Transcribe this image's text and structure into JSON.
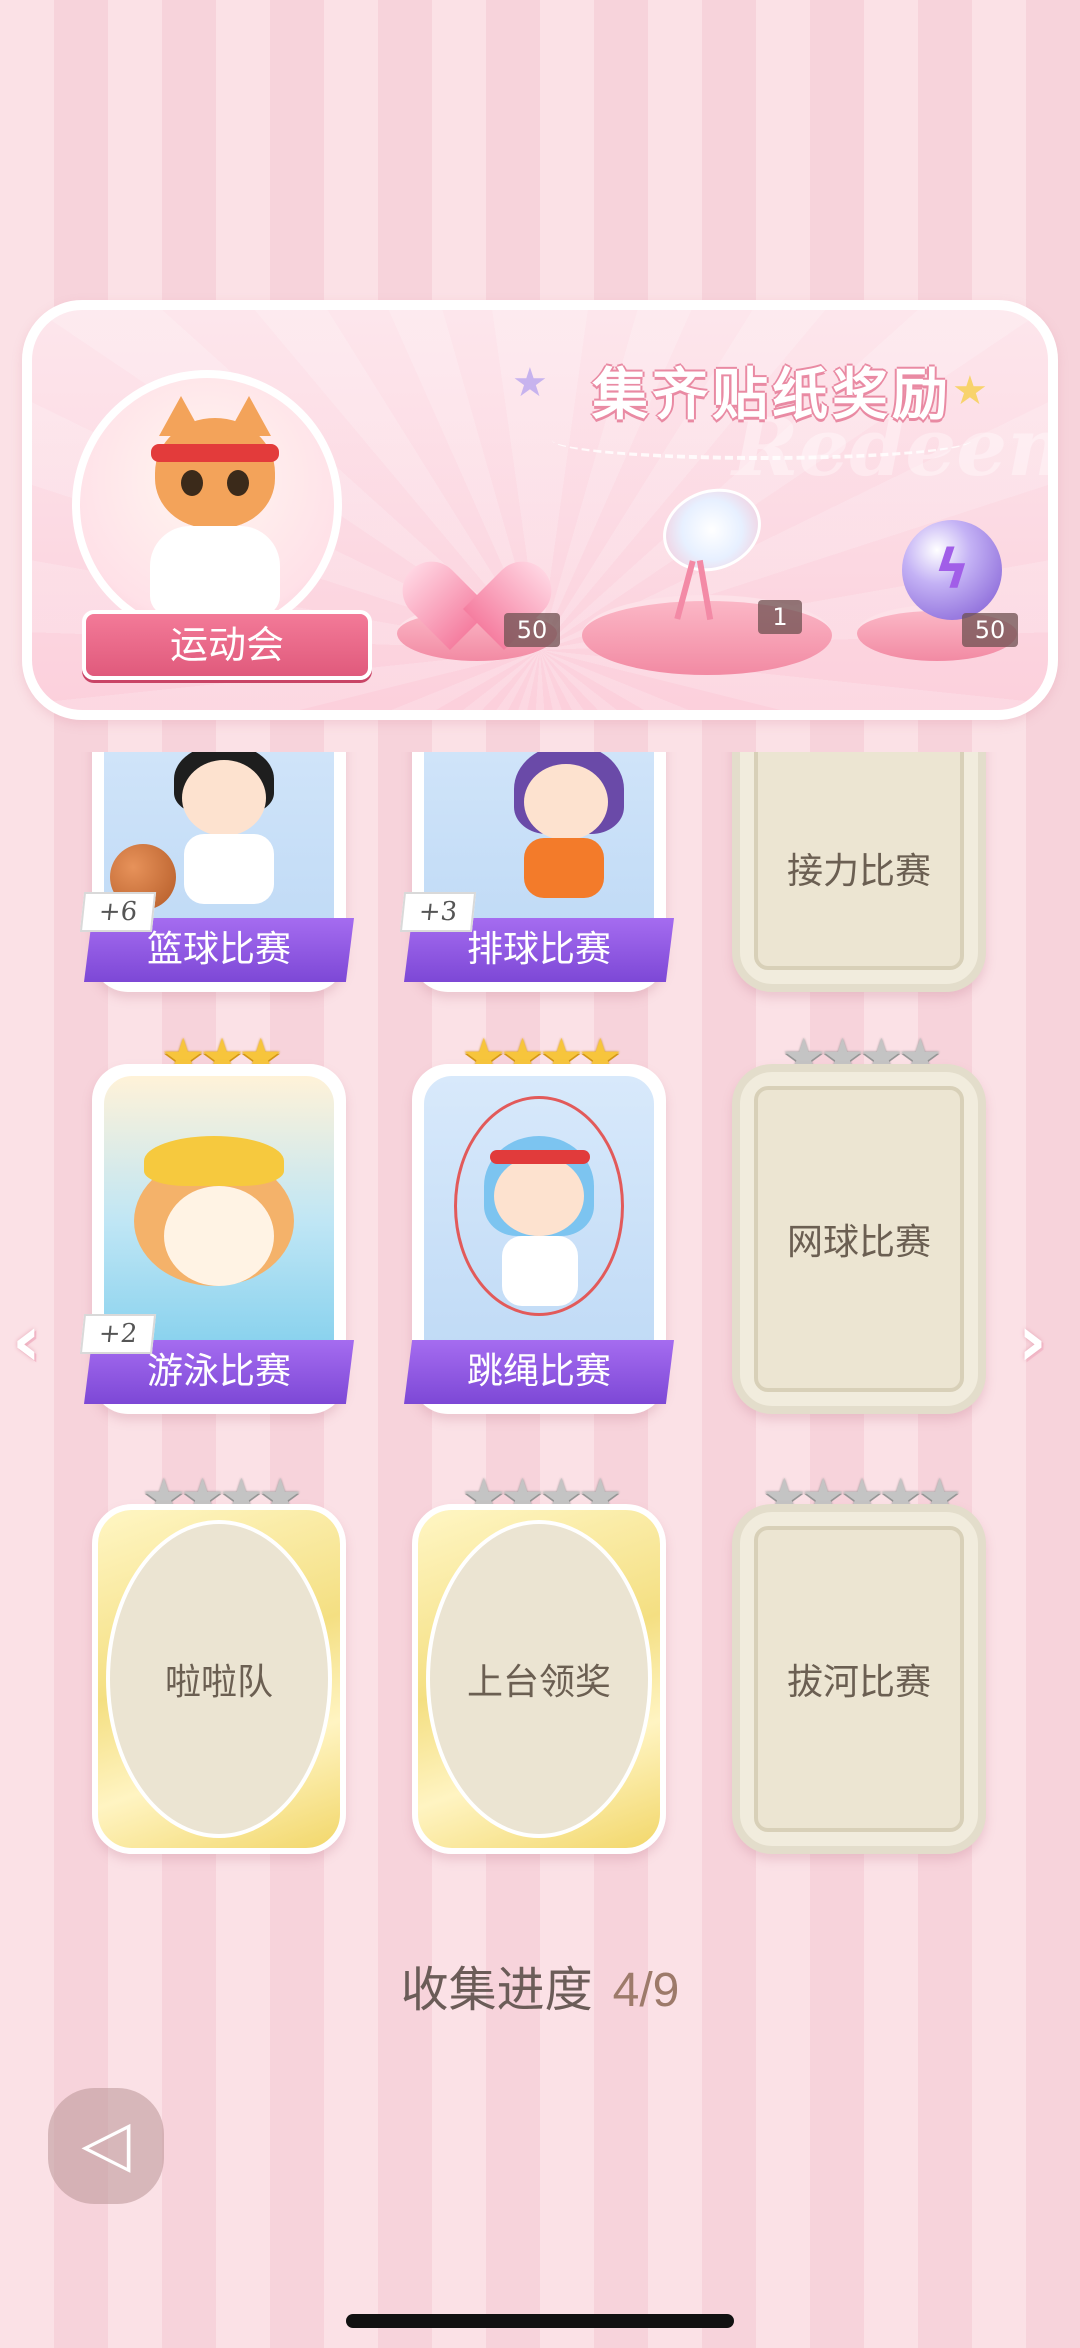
{
  "banner": {
    "title": "集齐贴纸奖励",
    "watermark": "Redeem",
    "event_name": "运动会",
    "rewards": [
      {
        "icon": "pink-heart-gem-icon",
        "count": "50"
      },
      {
        "icon": "crystal-fan-icon",
        "count": "1"
      },
      {
        "icon": "lightning-orb-icon",
        "count": "50"
      }
    ]
  },
  "stickers": [
    {
      "title": "篮球比赛",
      "state": "collected",
      "bonus": "+6",
      "stars_gold": 0,
      "stars_grey": 0
    },
    {
      "title": "排球比赛",
      "state": "collected",
      "bonus": "+3",
      "stars_gold": 0,
      "stars_grey": 0
    },
    {
      "title": "接力比赛",
      "state": "locked"
    },
    {
      "title": "游泳比赛",
      "state": "collected",
      "bonus": "+2",
      "stars_gold": 3,
      "stars_grey": 0
    },
    {
      "title": "跳绳比赛",
      "state": "collected",
      "bonus": "",
      "stars_gold": 4,
      "stars_grey": 0
    },
    {
      "title": "网球比赛",
      "state": "locked",
      "stars_gold": 0,
      "stars_grey": 4
    },
    {
      "title": "啦啦队",
      "state": "locked-special",
      "stars_gold": 0,
      "stars_grey": 4
    },
    {
      "title": "上台领奖",
      "state": "locked-special",
      "stars_gold": 0,
      "stars_grey": 4
    },
    {
      "title": "拔河比赛",
      "state": "locked",
      "stars_gold": 0,
      "stars_grey": 5
    }
  ],
  "progress": {
    "label": "收集进度",
    "value": "4/9"
  },
  "nav": {
    "prev_icon": "chevron-left-icon",
    "next_icon": "chevron-right-icon",
    "back_icon": "back-arrow-icon"
  },
  "colors": {
    "accent_purple": "#8a55e0",
    "banner_pink": "#f37a98",
    "star_gold": "#f7c53c"
  }
}
